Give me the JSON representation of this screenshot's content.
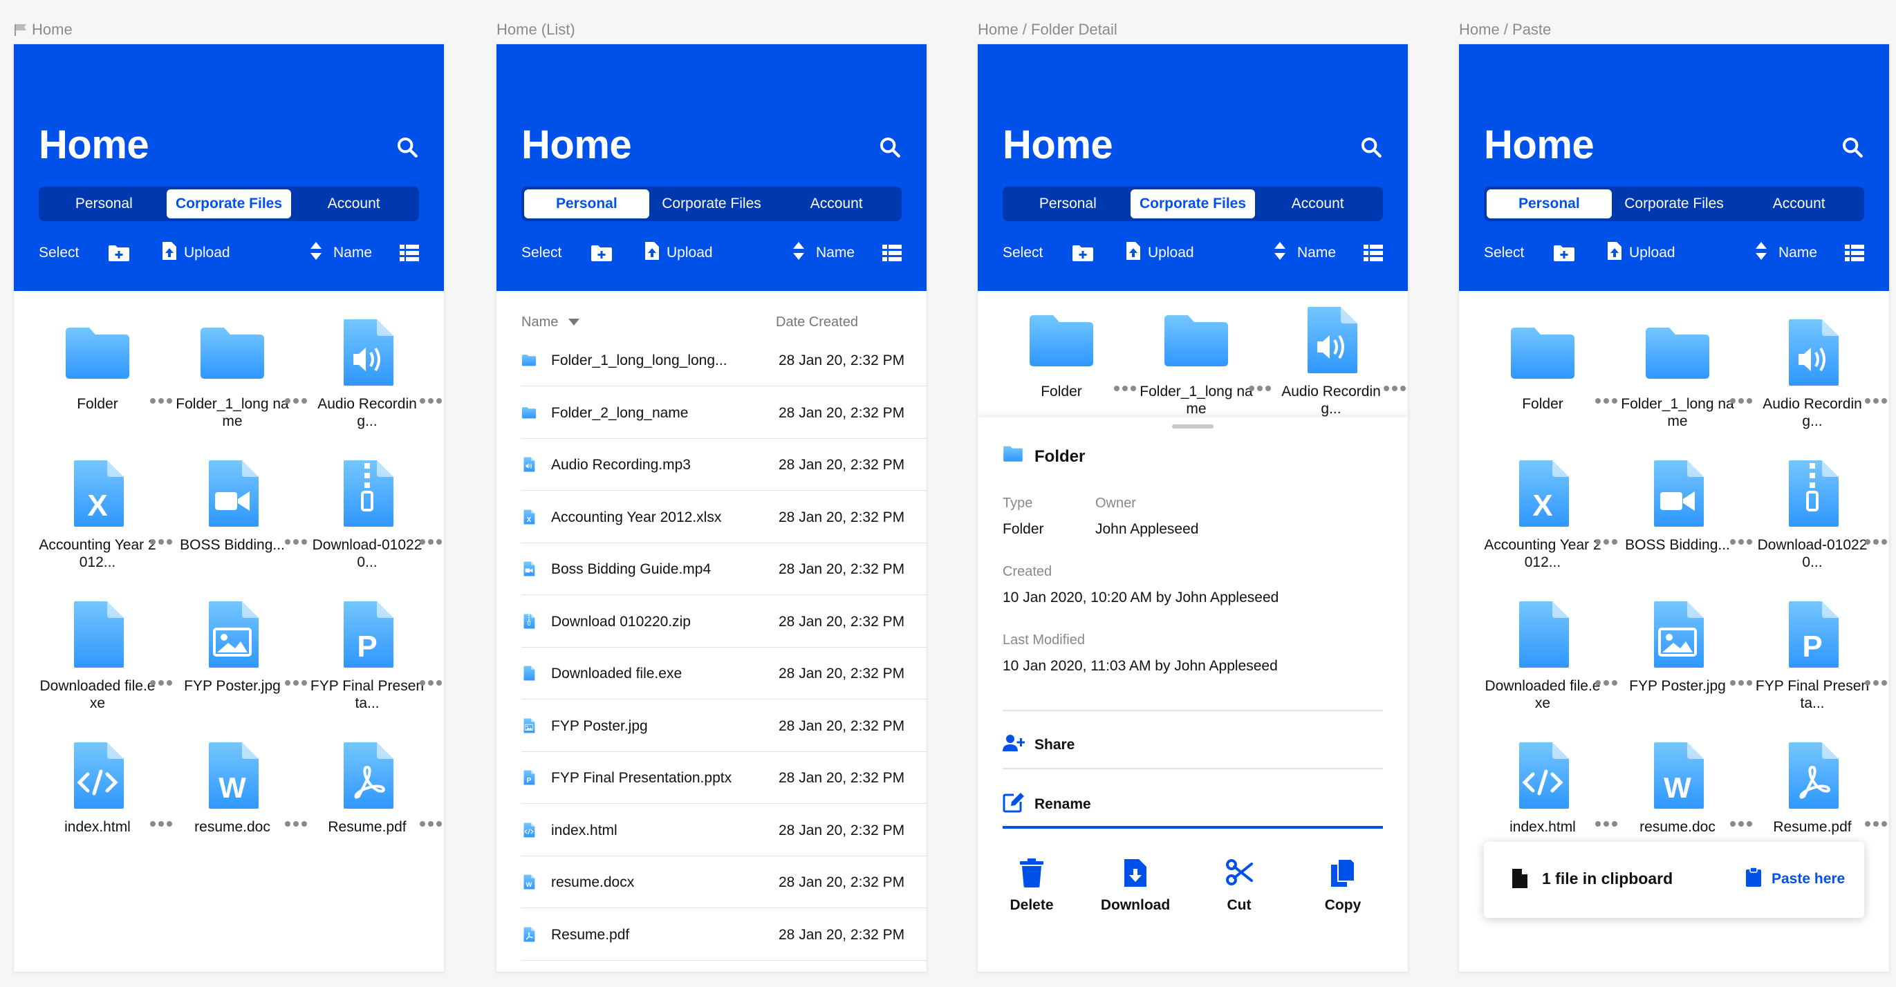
{
  "frames": [
    {
      "id": "home",
      "label": "Home",
      "view": "grid",
      "active_tab": 1,
      "sheet": false,
      "clipboard": false
    },
    {
      "id": "list",
      "label": "Home (List)",
      "view": "list",
      "active_tab": 0,
      "sheet": false,
      "clipboard": false
    },
    {
      "id": "detail",
      "label": "Home / Folder Detail",
      "view": "grid",
      "active_tab": 1,
      "sheet": true,
      "clipboard": false
    },
    {
      "id": "paste",
      "label": "Home / Paste",
      "view": "grid",
      "active_tab": 0,
      "sheet": false,
      "clipboard": true
    }
  ],
  "header": {
    "title": "Home",
    "tabs": [
      "Personal",
      "Corporate Files",
      "Account"
    ],
    "toolbar": {
      "select": "Select",
      "upload": "Upload",
      "sort": "Name"
    }
  },
  "files": [
    {
      "name": "Folder",
      "type": "folder"
    },
    {
      "name": "Folder_1_long name",
      "type": "folder"
    },
    {
      "name": "Audio Recording...",
      "type": "audio"
    },
    {
      "name": "Accounting Year 2012...",
      "type": "excel"
    },
    {
      "name": "BOSS Bidding...",
      "type": "video"
    },
    {
      "name": "Download-010220...",
      "type": "zip"
    },
    {
      "name": "Downloaded file.exe",
      "type": "file"
    },
    {
      "name": "FYP Poster.jpg",
      "type": "image"
    },
    {
      "name": "FYP Final Presenta...",
      "type": "ppt"
    },
    {
      "name": "index.html",
      "type": "code"
    },
    {
      "name": "resume.doc",
      "type": "word"
    },
    {
      "name": "Resume.pdf",
      "type": "pdf"
    }
  ],
  "list": {
    "name_header": "Name",
    "date_header": "Date Created",
    "rows": [
      {
        "name": "Folder_1_long_long_long...",
        "date": "28 Jan 20, 2:32 PM",
        "type": "folder"
      },
      {
        "name": "Folder_2_long_name",
        "date": "28 Jan 20, 2:32 PM",
        "type": "folder"
      },
      {
        "name": "Audio Recording.mp3",
        "date": "28 Jan 20, 2:32 PM",
        "type": "audio"
      },
      {
        "name": "Accounting Year 2012.xlsx",
        "date": "28 Jan 20, 2:32 PM",
        "type": "excel"
      },
      {
        "name": "Boss Bidding Guide.mp4",
        "date": "28 Jan 20, 2:32 PM",
        "type": "video"
      },
      {
        "name": "Download 010220.zip",
        "date": "28 Jan 20, 2:32 PM",
        "type": "zip"
      },
      {
        "name": "Downloaded file.exe",
        "date": "28 Jan 20, 2:32 PM",
        "type": "file"
      },
      {
        "name": "FYP Poster.jpg",
        "date": "28 Jan 20, 2:32 PM",
        "type": "image"
      },
      {
        "name": "FYP Final Presentation.pptx",
        "date": "28 Jan 20, 2:32 PM",
        "type": "ppt"
      },
      {
        "name": "index.html",
        "date": "28 Jan 20, 2:32 PM",
        "type": "code"
      },
      {
        "name": "resume.docx",
        "date": "28 Jan 20, 2:32 PM",
        "type": "word"
      },
      {
        "name": "Resume.pdf",
        "date": "28 Jan 20, 2:32 PM",
        "type": "pdf"
      }
    ]
  },
  "detail": {
    "title": "Folder",
    "type_label": "Type",
    "type_value": "Folder",
    "owner_label": "Owner",
    "owner_value": "John Appleseed",
    "created_label": "Created",
    "created_value": "10 Jan 2020, 10:20 AM by John Appleseed",
    "modified_label": "Last Modified",
    "modified_value": "10 Jan 2020, 11:03 AM by John Appleseed",
    "share": "Share",
    "rename": "Rename",
    "actions": [
      "Delete",
      "Download",
      "Cut",
      "Copy"
    ]
  },
  "clipboard": {
    "text": "1 file in clipboard",
    "paste": "Paste here"
  },
  "colors": {
    "brand": "#0051ea",
    "tabs_bg": "#0038b0",
    "icon_light": "#74c6ff",
    "icon_dark": "#2f97ff"
  },
  "icons": {
    "search": "search-icon",
    "new_folder": "folder-plus-icon",
    "upload": "upload-icon",
    "sort": "sort-icon",
    "view": "list-view-icon",
    "more": "more-icon",
    "share": "user-plus-icon",
    "rename": "edit-icon",
    "delete": "trash-icon",
    "download": "download-icon",
    "cut": "scissors-icon",
    "copy": "copy-icon",
    "document": "document-icon",
    "clipboard": "clipboard-icon",
    "flag": "flag-icon"
  }
}
